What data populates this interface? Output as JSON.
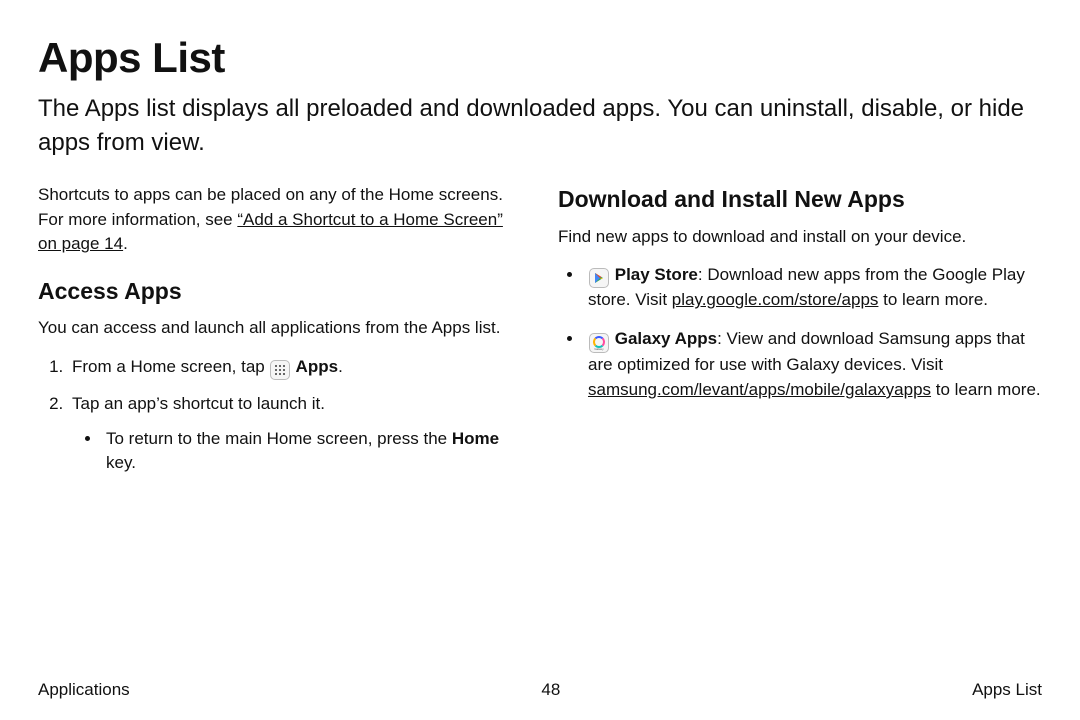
{
  "title": "Apps List",
  "intro": "The Apps list displays all preloaded and downloaded apps. You can uninstall, disable, or hide apps from view.",
  "left": {
    "shortcuts_pre": "Shortcuts to apps can be placed on any of the Home screens. For more information, see ",
    "shortcuts_link": "“Add a Shortcut to a Home Screen” on page 14",
    "shortcuts_post": ".",
    "h2": "Access Apps",
    "p1": "You can access and launch all applications from the Apps list.",
    "step1_pre": "From a Home screen, tap ",
    "step1_bold": " Apps",
    "step1_post": ".",
    "step2": "Tap an app’s shortcut to launch it.",
    "sub_pre": "To return to the main Home screen, press the ",
    "sub_bold": "Home",
    "sub_post": " key."
  },
  "right": {
    "h2": "Download and Install New Apps",
    "p1": "Find new apps to download and install on your device.",
    "item1_bold": "Play Store",
    "item1_mid": ": Download new apps from the Google Play store. Visit ",
    "item1_link": "play.google.com/store/apps",
    "item1_post": " to learn more.",
    "item2_bold": "Galaxy Apps",
    "item2_mid": ": View and download Samsung apps that are optimized for use with Galaxy devices. Visit ",
    "item2_link": "samsung.com/levant/apps/mobile/galaxyapps",
    "item2_post": " to learn more."
  },
  "footer": {
    "left": "Applications",
    "center": "48",
    "right": "Apps List"
  }
}
